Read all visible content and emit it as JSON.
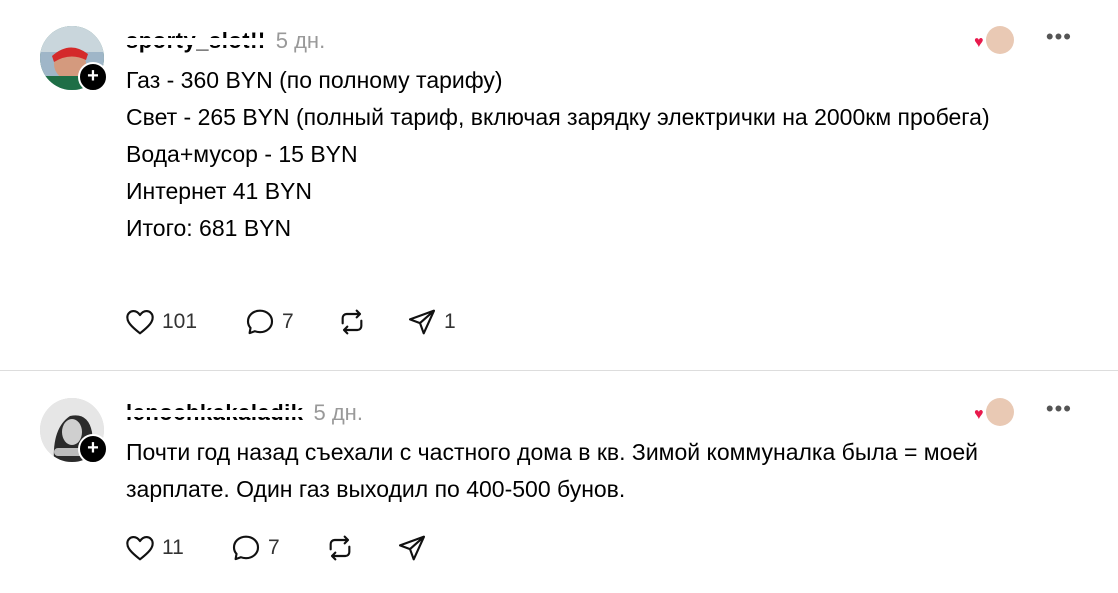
{
  "posts": [
    {
      "username": "sporty_slot!!",
      "time": "5 дн.",
      "body": [
        "Газ - 360 BYN (по полному тарифу)",
        "Свет - 265 BYN (полный тариф, включая зарядку электрички на 2000км пробега)",
        "Вода+мусор - 15 BYN",
        "Интернет 41 BYN",
        "Итого: 681 BYN"
      ],
      "likes": "101",
      "comments": "7",
      "shares": "1"
    },
    {
      "username": "lenochkakaladik",
      "time": "5 дн.",
      "body": [
        "Почти год назад съехали с частного дома в кв. Зимой коммуналка была = моей зарплате. Один газ выходил по 400-500 бунов."
      ],
      "likes": "11",
      "comments": "7",
      "shares": ""
    }
  ],
  "icons": {
    "like": "heart-outline-icon",
    "comment": "comment-bubble-icon",
    "repost": "repost-icon",
    "share": "send-icon",
    "more": "more-dots-icon",
    "follow": "plus-icon"
  },
  "colors": {
    "timestamp": "#999999",
    "reaction_heart": "#e8194c",
    "divider": "#dddddd"
  }
}
